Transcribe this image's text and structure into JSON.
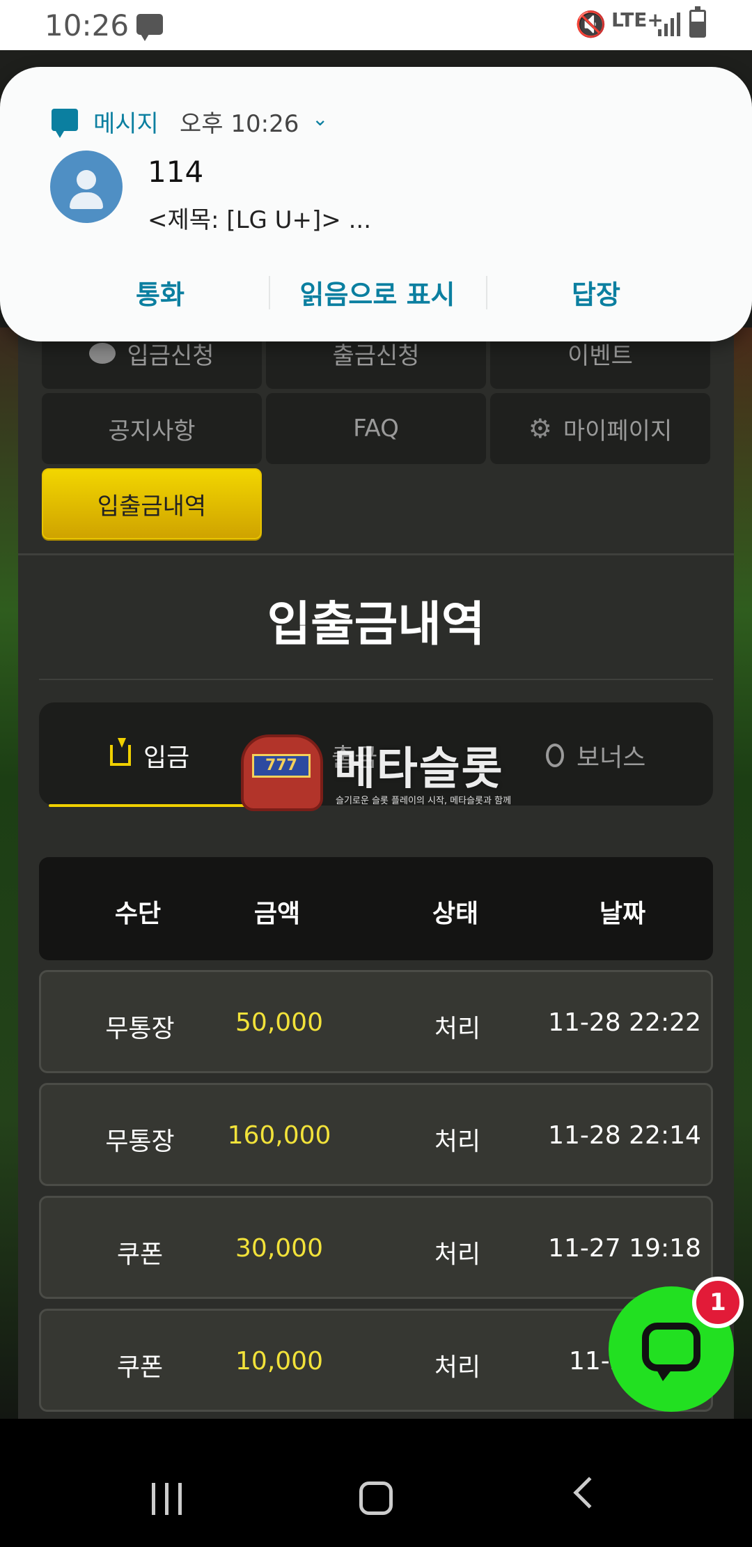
{
  "status_bar": {
    "time": "10:26",
    "network": "LTE+"
  },
  "notification": {
    "app_name": "메시지",
    "time": "오후 10:26",
    "sender": "114",
    "preview": "<제목: [LG U+]> ...",
    "actions": [
      "통화",
      "읽음으로 표시",
      "답장"
    ]
  },
  "nav_menu": {
    "deposit_request": "입금신청",
    "withdraw_request": "출금신청",
    "event": "이벤트",
    "notice": "공지사항",
    "faq": "FAQ",
    "mypage": "마이페이지",
    "history": "입출금내역"
  },
  "page_title": "입출금내역",
  "tabs": {
    "deposit": "입금",
    "withdraw": "출금",
    "bonus": "보너스"
  },
  "watermark": {
    "brand": "메타슬롯",
    "tagline": "슬기로운 슬롯 플레이의 시작, 메타슬롯과 함께",
    "reels": "777"
  },
  "table": {
    "headers": [
      "수단",
      "금액",
      "상태",
      "날짜"
    ],
    "rows": [
      {
        "method": "무통장",
        "amount": "50,000",
        "status": "처리",
        "date": "11-28 22:22"
      },
      {
        "method": "무통장",
        "amount": "160,000",
        "status": "처리",
        "date": "11-28 22:14"
      },
      {
        "method": "쿠폰",
        "amount": "30,000",
        "status": "처리",
        "date": "11-27 19:18"
      },
      {
        "method": "쿠폰",
        "amount": "10,000",
        "status": "처리",
        "date": "11-24"
      }
    ]
  },
  "chat": {
    "badge_count": "1"
  },
  "colors": {
    "accent_yellow": "#f0d000",
    "amount_yellow": "#f2e23a",
    "chat_green": "#22e021",
    "notif_blue": "#0b7fa0"
  }
}
